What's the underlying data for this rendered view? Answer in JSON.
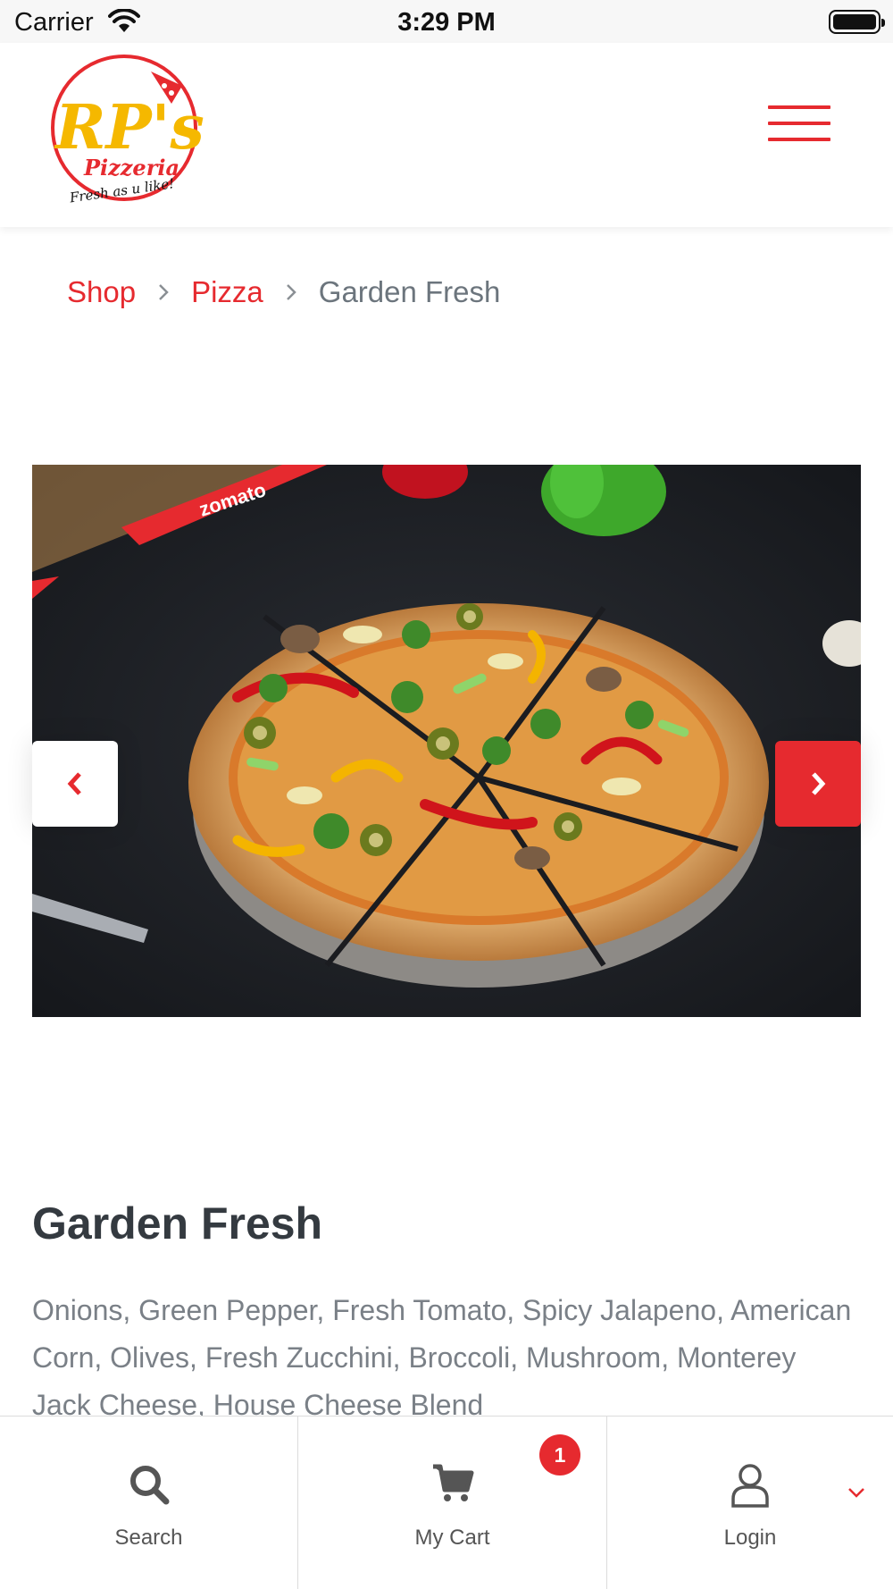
{
  "status_bar": {
    "carrier": "Carrier",
    "time": "3:29 PM"
  },
  "header": {
    "logo": {
      "brand": "RP's",
      "subtitle": "Pizzeria",
      "tagline": "Fresh as u like!"
    },
    "menu_icon": "hamburger-icon"
  },
  "breadcrumb": {
    "items": [
      "Shop",
      "Pizza"
    ],
    "current": "Garden Fresh"
  },
  "carousel": {
    "image_subject": "garden fresh pizza photo",
    "prev_icon": "chevron-left-icon",
    "next_icon": "chevron-right-icon"
  },
  "product": {
    "title": "Garden Fresh",
    "description": "Onions, Green Pepper, Fresh Tomato, Spicy Jalapeno, American Corn, Olives, Fresh Zucchini, Broccoli, Mushroom, Monterey Jack Cheese, House Cheese Blend"
  },
  "bottom_nav": {
    "search_label": "Search",
    "cart_label": "My Cart",
    "cart_count": "1",
    "login_label": "Login"
  },
  "colors": {
    "accent": "#e62a2f",
    "text_dark": "#343a40",
    "text_muted": "#7a8087"
  }
}
